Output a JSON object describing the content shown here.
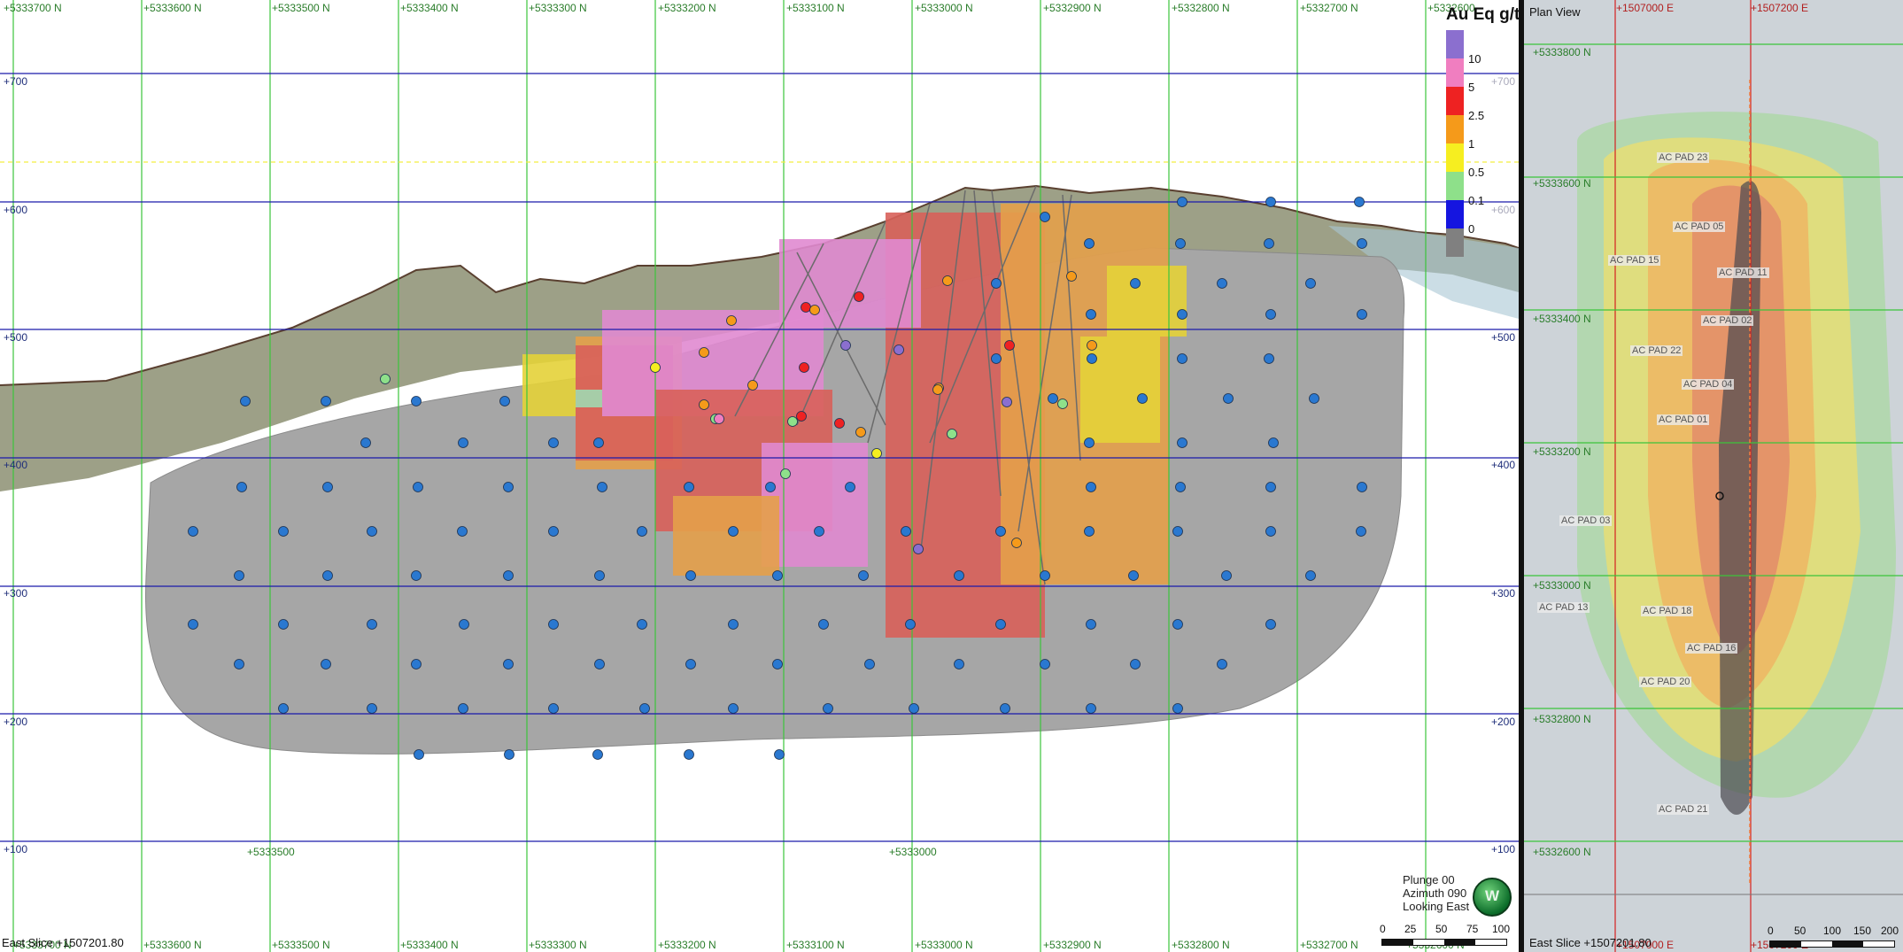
{
  "section": {
    "top_northings": [
      "+5333700 N",
      "+5333600 N",
      "+5333500 N",
      "+5333400 N",
      "+5333300 N",
      "+5333200 N",
      "+5333100 N",
      "+5333000 N",
      "+5332900 N",
      "+5332800 N",
      "+5332700 N",
      "+5332600"
    ],
    "bottom_northings": [
      "+5333700 N",
      "+5333600 N",
      "+5333500 N",
      "+5333400 N",
      "+5333300 N",
      "+5333200 N",
      "+5333100 N",
      "+5333000 N",
      "+5332900 N",
      "+5332800 N",
      "+5332700 N",
      "+5332600 N"
    ],
    "elevations_left": [
      "+700",
      "+600",
      "+500",
      "+400",
      "+300",
      "+200",
      "+100"
    ],
    "elevations_right": [
      "+700",
      "+600",
      "+500",
      "+400",
      "+300",
      "+200",
      "+100"
    ],
    "inner_labels": [
      "+5333500",
      "+5333000"
    ],
    "slice_label": "East Slice +1507201.80",
    "view": {
      "plunge": "Plunge 00",
      "azimuth": "Azimuth 090",
      "looking": "Looking East",
      "compass_letter": "W"
    },
    "scale": {
      "labels": [
        "0",
        "25",
        "50",
        "75",
        "100"
      ]
    }
  },
  "legend": {
    "title": "Au Eq g/t",
    "bins": [
      {
        "color": "#8b6fcf",
        "label": "10"
      },
      {
        "color": "#f07ec0",
        "label": "5"
      },
      {
        "color": "#ee2222",
        "label": "2.5"
      },
      {
        "color": "#f59a1a",
        "label": "1"
      },
      {
        "color": "#f6ee20",
        "label": "0.5"
      },
      {
        "color": "#8ee08a",
        "label": "0.1"
      },
      {
        "color": "#1515e0",
        "label": "0"
      },
      {
        "color": "#808080",
        "label": ""
      }
    ]
  },
  "plan": {
    "title": "Plan View",
    "top_eastings": [
      "+1507000 E",
      "+1507200 E"
    ],
    "bottom_eastings": [
      "+1507000 E",
      "+1507200 E"
    ],
    "northings": [
      "+5333800 N",
      "+5333600 N",
      "+5333400 N",
      "+5333200 N",
      "+5333000 N",
      "+5332800 N",
      "+5332600 N"
    ],
    "pads": [
      "AC PAD 23",
      "AC PAD 05",
      "AC PAD 15",
      "AC PAD 11",
      "AC PAD 02",
      "AC PAD 22",
      "AC PAD 04",
      "AC PAD 01",
      "AC PAD 03",
      "AC PAD 18",
      "AC PAD 16",
      "AC PAD 20",
      "AC PAD 21",
      "AC PAD 13"
    ],
    "slice_label": "East Slice +1507201.80",
    "scale_labels": [
      "0",
      "50",
      "100",
      "150",
      "200"
    ]
  },
  "colors": {
    "grid_vertical": "#3bc43b",
    "grid_horizontal": "#1b1bab",
    "block_default": "#a6a6a6",
    "sample_point": "#2a78d0"
  }
}
